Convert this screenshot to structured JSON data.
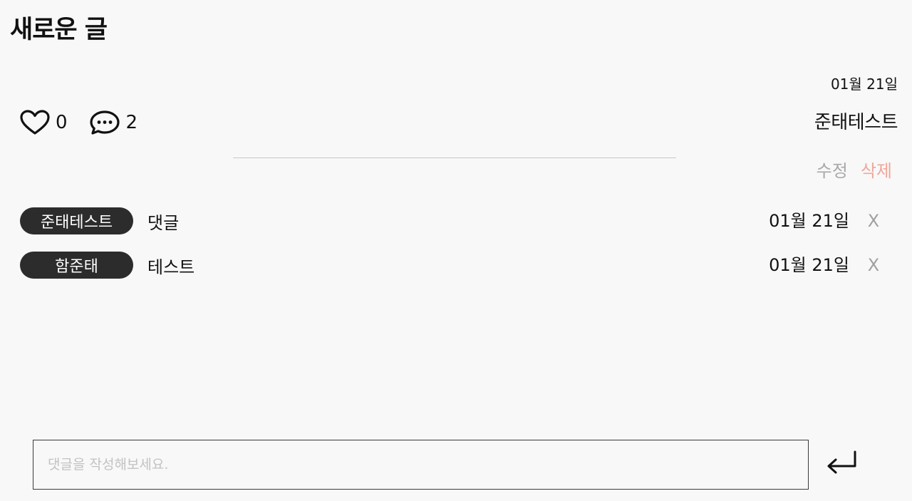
{
  "post": {
    "title": "새로운 글",
    "date": "01월 21일",
    "author": "준태테스트",
    "likes": "0",
    "comment_count": "2",
    "edit_label": "수정",
    "delete_label": "삭제"
  },
  "icons": {
    "like": "heart-outline-icon",
    "comments": "speech-bubble-icon",
    "submit": "enter-return-icon"
  },
  "colors": {
    "author_pill": "#2c2c2c",
    "delete_text": "#f0a79a",
    "edit_text": "#a8a8a8"
  },
  "comments": [
    {
      "author": "준태테스트",
      "text": "댓글",
      "date": "01월 21일",
      "delete_label": "X"
    },
    {
      "author": "함준태",
      "text": "테스트",
      "date": "01월 21일",
      "delete_label": "X"
    }
  ],
  "comment_form": {
    "placeholder": "댓글을 작성해보세요.",
    "value": ""
  }
}
